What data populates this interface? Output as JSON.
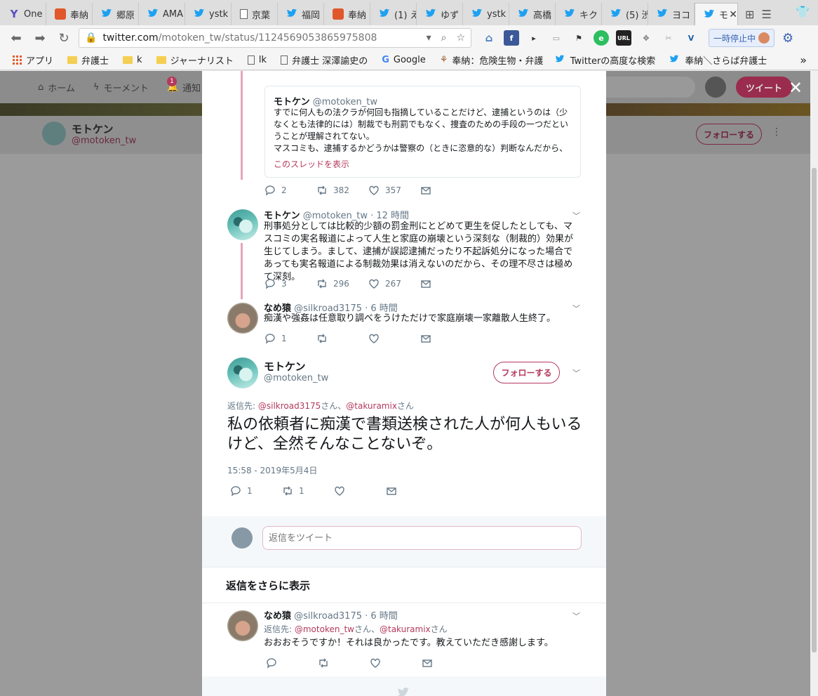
{
  "browser": {
    "tabs": [
      {
        "label": "One",
        "icon": "y-icon"
      },
      {
        "label": "奉納",
        "icon": "hono-icon"
      },
      {
        "label": "郷原",
        "icon": "twitter-icon"
      },
      {
        "label": "AMA",
        "icon": "twitter-icon"
      },
      {
        "label": "ystk",
        "icon": "twitter-icon"
      },
      {
        "label": "京葉",
        "icon": "doc-icon"
      },
      {
        "label": "福岡",
        "icon": "twitter-icon"
      },
      {
        "label": "奉納",
        "icon": "hono-icon"
      },
      {
        "label": "(1) え",
        "icon": "twitter-icon"
      },
      {
        "label": "ゆず",
        "icon": "twitter-icon"
      },
      {
        "label": "ystk",
        "icon": "twitter-icon"
      },
      {
        "label": "高橋",
        "icon": "twitter-icon"
      },
      {
        "label": "キク",
        "icon": "twitter-icon"
      },
      {
        "label": "(5) 渋",
        "icon": "twitter-icon"
      },
      {
        "label": "ヨコ",
        "icon": "twitter-icon"
      },
      {
        "label": "モ",
        "icon": "twitter-icon",
        "active": true
      }
    ],
    "url_host": "twitter.com",
    "url_path": "/motoken_tw/status/1124569053865975808",
    "pause_label": "一時停止中",
    "bookmarks": [
      "アプリ",
      "弁護士",
      "k",
      "ジャーナリスト",
      "lk",
      "弁護士 深澤諭史の",
      "Google",
      "奉納：危険生物・弁護",
      "Twitterの高度な検索",
      "奉納＼さらば弁護士"
    ]
  },
  "twitter_nav": {
    "home": "ホーム",
    "moments": "モーメント",
    "notifications": "通知",
    "notification_count": "1",
    "tweet_button": "ツイート"
  },
  "profile": {
    "name": "モトケン",
    "handle": "@motoken_tw",
    "follow_label": "フォローする"
  },
  "quote": {
    "name": "モトケン",
    "handle": "@motoken_tw",
    "text": "すでに何人もの法クラが何回も指摘していることだけど、逮捕というのは（少なくとも法律的には）制裁でも刑罰でもなく、捜査のための手段の一つだということが理解されてない。\nマスコミも、逮捕するかどうかは警察の（ときに恣意的な）判断なんだから、逮…",
    "thread_link": "このスレッドを表示"
  },
  "tweets": [
    {
      "replies": "2",
      "retweets": "382",
      "likes": "357"
    },
    {
      "name": "モトケン",
      "handle": "@motoken_tw",
      "time": "· 12 時間",
      "text": "刑事処分としては比較的少額の罰金刑にとどめて更生を促したとしても、マスコミの実名報道によって人生と家庭の崩壊という深刻な（制裁的）効果が生じてしまう。まして、逮捕が誤認逮捕だったり不起訴処分になった場合であっても実名報道による制裁効果は消えないのだから、その理不尽さは極めて深刻。",
      "replies": "3",
      "retweets": "296",
      "likes": "267"
    },
    {
      "name": "なめ猿",
      "handle": "@silkroad3175",
      "time": "· 6 時間",
      "text": "痴漢や強姦は任意取り調べをうけただけで家庭崩壊一家離散人生終了。",
      "replies": "1",
      "retweets": "",
      "likes": ""
    }
  ],
  "main_tweet": {
    "name": "モトケン",
    "handle": "@motoken_tw",
    "follow_label": "フォローする",
    "reply_prefix": "返信先: ",
    "mention1": "@silkroad3175",
    "san1": "さん、",
    "mention2": "@takuramix",
    "san2": "さん",
    "text": "私の依頼者に痴漢で書類送検された人が何人もいるけど、全然そんなことないぞ。",
    "timestamp": "15:58 - 2019年5月4日",
    "replies": "1",
    "retweets": "1"
  },
  "reply_box": {
    "placeholder": "返信をツイート"
  },
  "more_replies": "返信をさらに表示",
  "reply": {
    "name": "なめ猿",
    "handle": "@silkroad3175",
    "time": "· 6 時間",
    "reply_prefix": "返信先: ",
    "mention1": "@motoken_tw",
    "san1": "さん、",
    "mention2": "@takuramix",
    "san2": "さん",
    "text": "おおおそうですか！それは良かったです。教えていただき感謝します。"
  },
  "colors": {
    "accent": "#b3395d",
    "thread_line": "#e4a5bd",
    "overlay": "#9b9b9b"
  }
}
